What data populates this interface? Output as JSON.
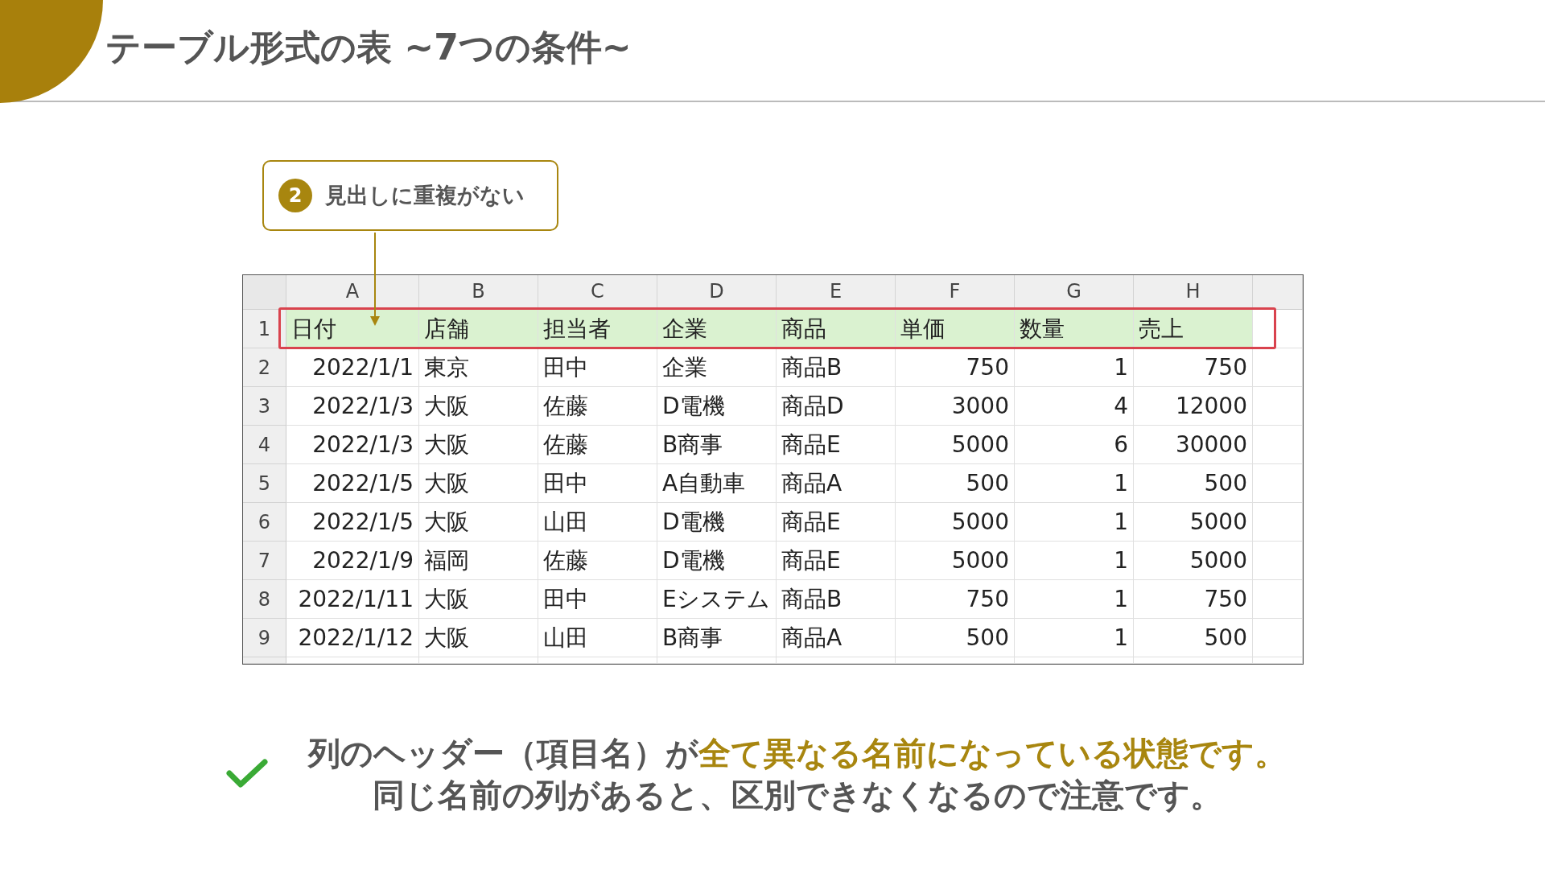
{
  "title": "テーブル形式の表 ~7つの条件~",
  "callout": {
    "number": "2",
    "text": "見出しに重複がない"
  },
  "sheet": {
    "columns": [
      {
        "letter": "A",
        "numeric": true
      },
      {
        "letter": "B",
        "numeric": false
      },
      {
        "letter": "C",
        "numeric": false
      },
      {
        "letter": "D",
        "numeric": false
      },
      {
        "letter": "E",
        "numeric": false
      },
      {
        "letter": "F",
        "numeric": true
      },
      {
        "letter": "G",
        "numeric": true
      },
      {
        "letter": "H",
        "numeric": true
      }
    ],
    "rows": [
      {
        "number": "1",
        "highlighted": true,
        "cells": [
          "日付",
          "店舗",
          "担当者",
          "企業",
          "商品",
          "単価",
          "数量",
          "売上"
        ]
      },
      {
        "number": "2",
        "highlighted": false,
        "cells": [
          "2022/1/1",
          "東京",
          "田中",
          "企業",
          "商品B",
          "750",
          "1",
          "750"
        ]
      },
      {
        "number": "3",
        "highlighted": false,
        "cells": [
          "2022/1/3",
          "大阪",
          "佐藤",
          "D電機",
          "商品D",
          "3000",
          "4",
          "12000"
        ]
      },
      {
        "number": "4",
        "highlighted": false,
        "cells": [
          "2022/1/3",
          "大阪",
          "佐藤",
          "B商事",
          "商品E",
          "5000",
          "6",
          "30000"
        ]
      },
      {
        "number": "5",
        "highlighted": false,
        "cells": [
          "2022/1/5",
          "大阪",
          "田中",
          "A自動車",
          "商品A",
          "500",
          "1",
          "500"
        ]
      },
      {
        "number": "6",
        "highlighted": false,
        "cells": [
          "2022/1/5",
          "大阪",
          "山田",
          "D電機",
          "商品E",
          "5000",
          "1",
          "5000"
        ]
      },
      {
        "number": "7",
        "highlighted": false,
        "cells": [
          "2022/1/9",
          "福岡",
          "佐藤",
          "D電機",
          "商品E",
          "5000",
          "1",
          "5000"
        ]
      },
      {
        "number": "8",
        "highlighted": false,
        "cells": [
          "2022/1/11",
          "大阪",
          "田中",
          "Eシステム",
          "商品B",
          "750",
          "1",
          "750"
        ]
      },
      {
        "number": "9",
        "highlighted": false,
        "cells": [
          "2022/1/12",
          "大阪",
          "山田",
          "B商事",
          "商品A",
          "500",
          "1",
          "500"
        ]
      }
    ]
  },
  "note": {
    "lines": [
      "列のヘッダー（項目名）が**全て異なる名前になっている状態です。**",
      "同じ名前の列があると、区別できなくなるので注意です。"
    ]
  }
}
